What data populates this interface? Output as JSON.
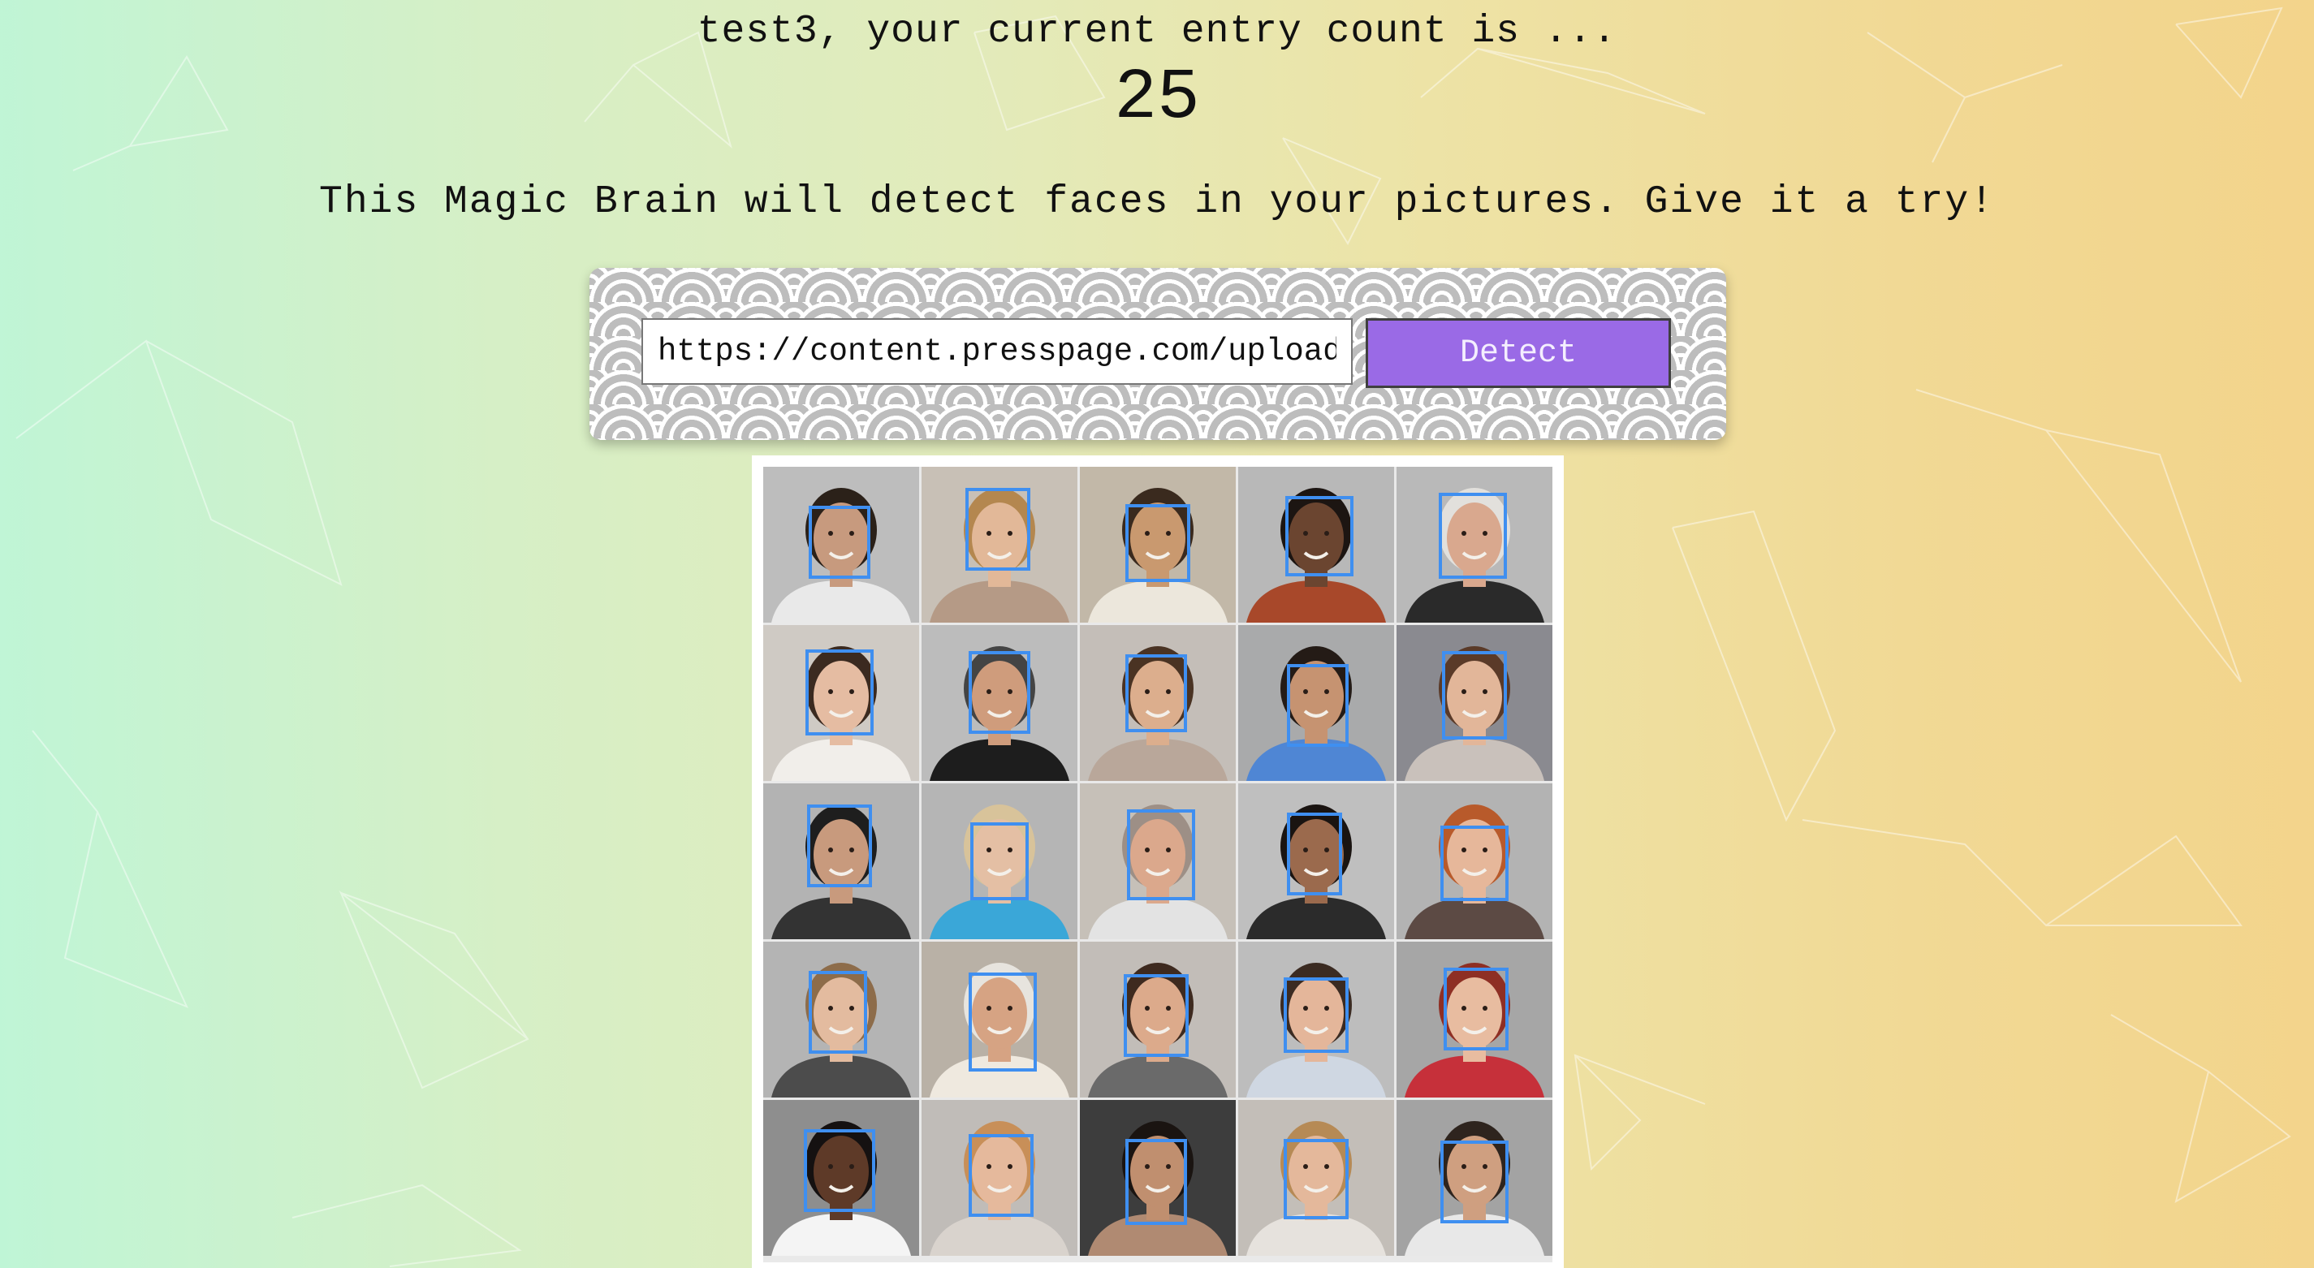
{
  "user": {
    "greeting": "test3, your current entry count is ...",
    "entry_count": "25"
  },
  "intro_text": "This Magic Brain will detect faces in your pictures. Give it a try!",
  "form": {
    "url_value": "https://content.presspage.com/uploads/",
    "detect_label": "Detect",
    "button_color": "#9a6ae6",
    "box_color": "#3f8ff0"
  },
  "image": {
    "rows": 5,
    "columns": 5,
    "detected_faces": 25,
    "portraits": [
      {
        "bg": "#bdbdbd",
        "skin": "#c79a7e",
        "hair": "#2b2119",
        "shirt": "#e9e9e9"
      },
      {
        "bg": "#c8c0b6",
        "skin": "#e2b898",
        "hair": "#b4874f",
        "shirt": "#b59a86"
      },
      {
        "bg": "#c2b8a8",
        "skin": "#c9996f",
        "hair": "#3a2a1e",
        "shirt": "#ece7dc"
      },
      {
        "bg": "#b8b8b8",
        "skin": "#6b4530",
        "hair": "#1c1512",
        "shirt": "#a8482a"
      },
      {
        "bg": "#b9b9b9",
        "skin": "#d9a88e",
        "hair": "#e2e0dc",
        "shirt": "#2a2a2a"
      },
      {
        "bg": "#cfcac4",
        "skin": "#e5bca2",
        "hair": "#3b2a20",
        "shirt": "#f1eeea"
      },
      {
        "bg": "#bcbcbc",
        "skin": "#cf9c7c",
        "hair": "#444444",
        "shirt": "#1d1d1d"
      },
      {
        "bg": "#c4beb8",
        "skin": "#dcae8d",
        "hair": "#4a3323",
        "shirt": "#b9a79a"
      },
      {
        "bg": "#a9aaab",
        "skin": "#c69371",
        "hair": "#241b16",
        "shirt": "#4f86d4"
      },
      {
        "bg": "#8a8a90",
        "skin": "#e2b699",
        "hair": "#5a3a28",
        "shirt": "#c9c1bb"
      },
      {
        "bg": "#b3b3b3",
        "skin": "#c89a7d",
        "hair": "#1e1e1e",
        "shirt": "#333333"
      },
      {
        "bg": "#b5b5b5",
        "skin": "#e4bfa4",
        "hair": "#d8c39a",
        "shirt": "#3aa7d8"
      },
      {
        "bg": "#c6c0b8",
        "skin": "#dba88c",
        "hair": "#9d8f86",
        "shirt": "#e3e3e3"
      },
      {
        "bg": "#bfbfbf",
        "skin": "#9b6a4d",
        "hair": "#1a1411",
        "shirt": "#2b2b2b"
      },
      {
        "bg": "#b3b3b3",
        "skin": "#e6b79a",
        "hair": "#b85a2b",
        "shirt": "#5c4a44"
      },
      {
        "bg": "#b4b4b4",
        "skin": "#e3bb9f",
        "hair": "#8d6c4a",
        "shirt": "#4c4c4c"
      },
      {
        "bg": "#b9b1a6",
        "skin": "#d6a383",
        "hair": "#e7e4de",
        "shirt": "#efe9df"
      },
      {
        "bg": "#c2bdb8",
        "skin": "#dcaa8b",
        "hair": "#3e2a1f",
        "shirt": "#6a6a6a"
      },
      {
        "bg": "#bdbdbd",
        "skin": "#e4b69a",
        "hair": "#3b2b22",
        "shirt": "#cfd7e2"
      },
      {
        "bg": "#a6a6a6",
        "skin": "#e8bca0",
        "hair": "#8e2f24",
        "shirt": "#c6303a"
      },
      {
        "bg": "#8e8e8e",
        "skin": "#5e3a28",
        "hair": "#151111",
        "shirt": "#f4f4f4"
      },
      {
        "bg": "#c0bcb8",
        "skin": "#e5b99c",
        "hair": "#c88f58",
        "shirt": "#d9d3cd"
      },
      {
        "bg": "#3d3d3d",
        "skin": "#c08f6f",
        "hair": "#1a1411",
        "shirt": "#b08a72"
      },
      {
        "bg": "#c3beb8",
        "skin": "#e4b89b",
        "hair": "#b68a55",
        "shirt": "#e6e2dd"
      },
      {
        "bg": "#a3a3a3",
        "skin": "#cf9f80",
        "hair": "#2e241e",
        "shirt": "#e8e8e8"
      }
    ]
  }
}
